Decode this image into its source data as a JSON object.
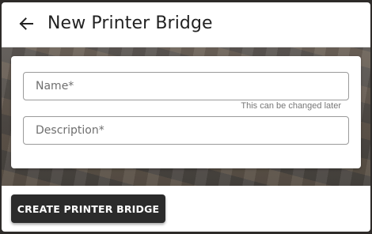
{
  "header": {
    "title": "New Printer Bridge",
    "back_icon": "arrow-left-icon"
  },
  "form": {
    "name_placeholder": "Name*",
    "name_value": "",
    "name_hint": "This can be changed later",
    "description_placeholder": "Description*",
    "description_value": ""
  },
  "footer": {
    "create_label": "CREATE PRINTER BRIDGE"
  },
  "colors": {
    "header_bg": "#ffffff",
    "button_bg": "#2b2b2b",
    "button_text": "#ffffff",
    "field_border": "#9a9a9a"
  }
}
